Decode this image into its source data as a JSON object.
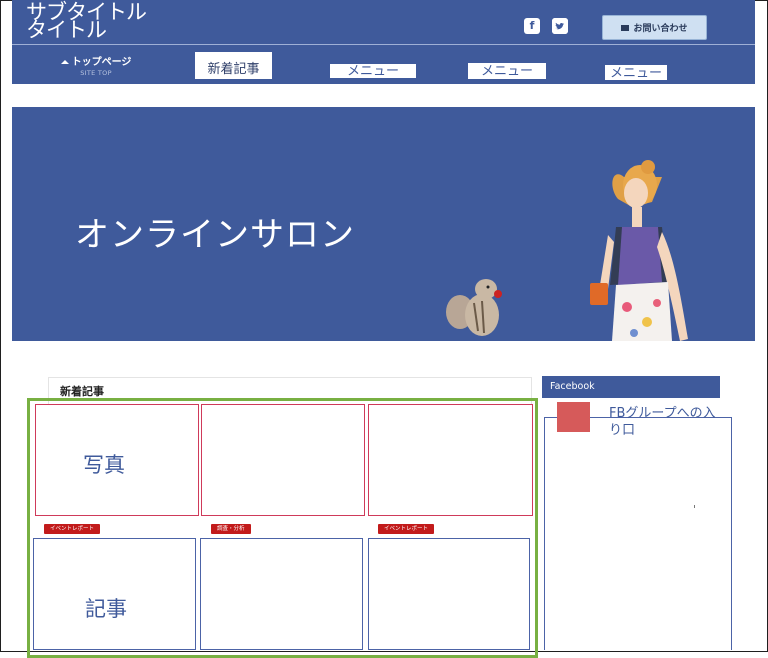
{
  "header": {
    "title_line1": "サブタイトル",
    "title_line2": "タイトル",
    "social_icons": [
      "facebook-icon",
      "twitter-icon"
    ],
    "contact_label": "お問い合わせ",
    "home_label": "トップページ",
    "home_sub": "SITE TOP",
    "nav_items": [
      "新着記事",
      "メニュー",
      "メニュー",
      "メニュー"
    ]
  },
  "hero": {
    "title": "オンラインサロン"
  },
  "main": {
    "section_title": "新着記事",
    "photo_placeholder": "写真",
    "article_placeholder": "記事",
    "tags": [
      "イベントレポート",
      "調査・分析",
      "イベントレポート"
    ]
  },
  "sidebar": {
    "facebook_title": "Facebook",
    "fb_group_link": "FBグループへの入り口"
  },
  "colors": {
    "brand": "#3f5a9b",
    "accent_green": "#78b042",
    "tag_red": "#c21b1b",
    "photo_border": "#cf3a5a"
  }
}
